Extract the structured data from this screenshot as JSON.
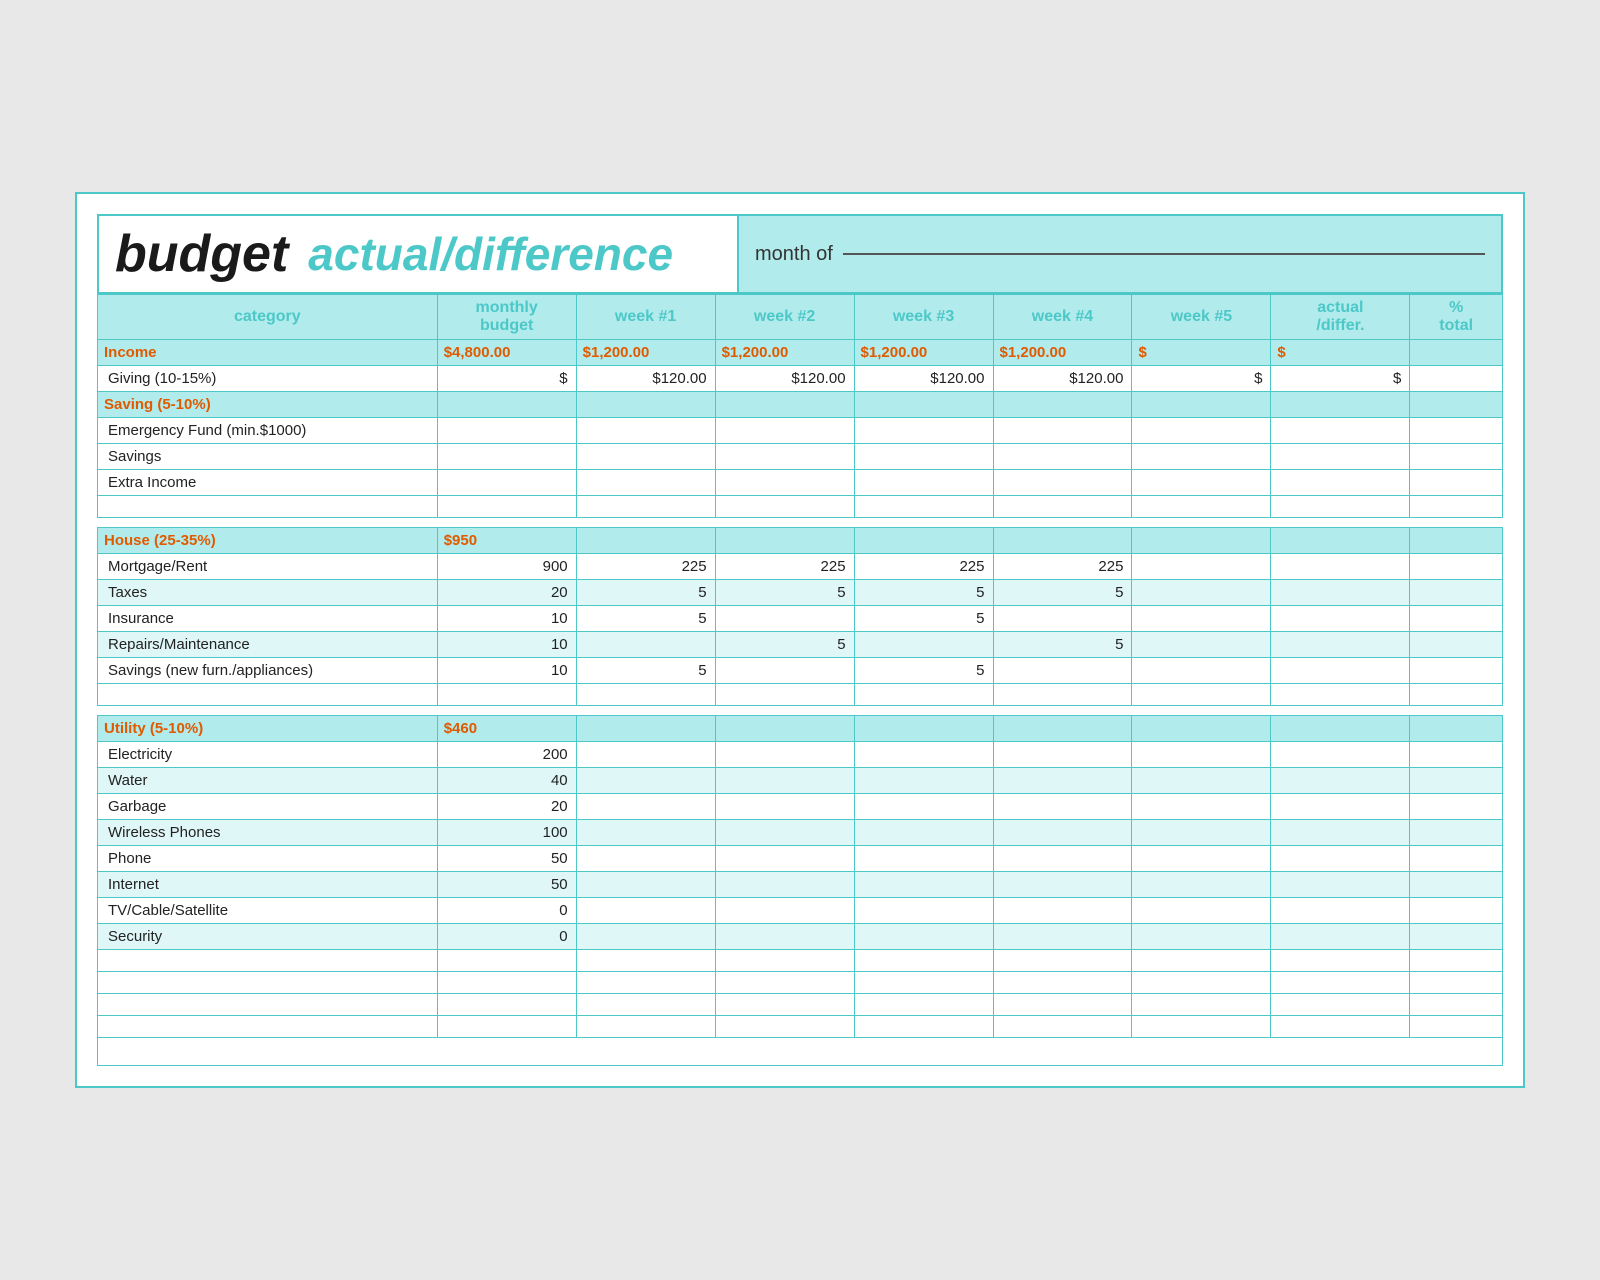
{
  "header": {
    "budget_word": "budget",
    "actual_diff": "actual/difference",
    "month_of_label": "month of"
  },
  "columns": {
    "category": "category",
    "monthly_budget": "monthly\nbudget",
    "week1": "week #1",
    "week2": "week #2",
    "week3": "week #3",
    "week4": "week #4",
    "week5": "week #5",
    "actual_differ": "actual\n/differ.",
    "pct_total": "%\ntotal"
  },
  "sections": [
    {
      "header": {
        "category": "Income",
        "monthly_budget": "$4,800.00",
        "week1": "$1,200.00",
        "week2": "$1,200.00",
        "week3": "$1,200.00",
        "week4": "$1,200.00",
        "week5": "$",
        "actual": "$",
        "pct": ""
      },
      "is_income": true,
      "rows": [
        {
          "category": "Giving (10-15%)",
          "monthly_budget": "$",
          "week1": "$120.00",
          "week2": "$120.00",
          "week3": "$120.00",
          "week4": "$120.00",
          "week5": "$",
          "actual": "$",
          "pct": ""
        },
        {
          "category": "Saving (5-10%)",
          "monthly_budget": "",
          "week1": "",
          "week2": "",
          "week3": "",
          "week4": "",
          "week5": "",
          "actual": "",
          "pct": "",
          "section": true
        },
        {
          "category": "Emergency Fund (min.$1000)",
          "monthly_budget": "",
          "week1": "",
          "week2": "",
          "week3": "",
          "week4": "",
          "week5": "",
          "actual": "",
          "pct": ""
        },
        {
          "category": "Savings",
          "monthly_budget": "",
          "week1": "",
          "week2": "",
          "week3": "",
          "week4": "",
          "week5": "",
          "actual": "",
          "pct": ""
        },
        {
          "category": "Extra Income",
          "monthly_budget": "",
          "week1": "",
          "week2": "",
          "week3": "",
          "week4": "",
          "week5": "",
          "actual": "",
          "pct": ""
        },
        {
          "category": "",
          "monthly_budget": "",
          "week1": "",
          "week2": "",
          "week3": "",
          "week4": "",
          "week5": "",
          "actual": "",
          "pct": "",
          "empty": true
        }
      ]
    },
    {
      "header": {
        "category": "House (25-35%)",
        "monthly_budget": "$950",
        "week1": "",
        "week2": "",
        "week3": "",
        "week4": "",
        "week5": "",
        "actual": "",
        "pct": ""
      },
      "rows": [
        {
          "category": "Mortgage/Rent",
          "monthly_budget": "900",
          "week1": "225",
          "week2": "225",
          "week3": "225",
          "week4": "225",
          "week5": "",
          "actual": "",
          "pct": ""
        },
        {
          "category": "Taxes",
          "monthly_budget": "20",
          "week1": "5",
          "week2": "5",
          "week3": "5",
          "week4": "5",
          "week5": "",
          "actual": "",
          "pct": "",
          "teal": true
        },
        {
          "category": "Insurance",
          "monthly_budget": "10",
          "week1": "5",
          "week2": "",
          "week3": "5",
          "week4": "",
          "week5": "",
          "actual": "",
          "pct": ""
        },
        {
          "category": "Repairs/Maintenance",
          "monthly_budget": "10",
          "week1": "",
          "week2": "5",
          "week3": "",
          "week4": "5",
          "week5": "",
          "actual": "",
          "pct": "",
          "teal": true
        },
        {
          "category": "Savings (new furn./appliances)",
          "monthly_budget": "10",
          "week1": "5",
          "week2": "",
          "week3": "5",
          "week4": "",
          "week5": "",
          "actual": "",
          "pct": ""
        },
        {
          "category": "",
          "monthly_budget": "",
          "week1": "",
          "week2": "",
          "week3": "",
          "week4": "",
          "week5": "",
          "actual": "",
          "pct": "",
          "empty": true
        }
      ]
    },
    {
      "header": {
        "category": "Utility (5-10%)",
        "monthly_budget": "$460",
        "week1": "",
        "week2": "",
        "week3": "",
        "week4": "",
        "week5": "",
        "actual": "",
        "pct": ""
      },
      "rows": [
        {
          "category": "Electricity",
          "monthly_budget": "200",
          "week1": "",
          "week2": "",
          "week3": "",
          "week4": "",
          "week5": "",
          "actual": "",
          "pct": ""
        },
        {
          "category": "Water",
          "monthly_budget": "40",
          "week1": "",
          "week2": "",
          "week3": "",
          "week4": "",
          "week5": "",
          "actual": "",
          "pct": "",
          "teal": true
        },
        {
          "category": "Garbage",
          "monthly_budget": "20",
          "week1": "",
          "week2": "",
          "week3": "",
          "week4": "",
          "week5": "",
          "actual": "",
          "pct": ""
        },
        {
          "category": "Wireless Phones",
          "monthly_budget": "100",
          "week1": "",
          "week2": "",
          "week3": "",
          "week4": "",
          "week5": "",
          "actual": "",
          "pct": "",
          "teal": true
        },
        {
          "category": "Phone",
          "monthly_budget": "50",
          "week1": "",
          "week2": "",
          "week3": "",
          "week4": "",
          "week5": "",
          "actual": "",
          "pct": ""
        },
        {
          "category": "Internet",
          "monthly_budget": "50",
          "week1": "",
          "week2": "",
          "week3": "",
          "week4": "",
          "week5": "",
          "actual": "",
          "pct": "",
          "teal": true
        },
        {
          "category": "TV/Cable/Satellite",
          "monthly_budget": "0",
          "week1": "",
          "week2": "",
          "week3": "",
          "week4": "",
          "week5": "",
          "actual": "",
          "pct": ""
        },
        {
          "category": "Security",
          "monthly_budget": "0",
          "week1": "",
          "week2": "",
          "week3": "",
          "week4": "",
          "week5": "",
          "actual": "",
          "pct": "",
          "teal": true
        },
        {
          "category": "",
          "monthly_budget": "",
          "week1": "",
          "week2": "",
          "week3": "",
          "week4": "",
          "week5": "",
          "actual": "",
          "pct": "",
          "empty": true
        },
        {
          "category": "",
          "monthly_budget": "",
          "week1": "",
          "week2": "",
          "week3": "",
          "week4": "",
          "week5": "",
          "actual": "",
          "pct": "",
          "empty": true
        },
        {
          "category": "",
          "monthly_budget": "",
          "week1": "",
          "week2": "",
          "week3": "",
          "week4": "",
          "week5": "",
          "actual": "",
          "pct": "",
          "empty": true
        },
        {
          "category": "",
          "monthly_budget": "",
          "week1": "",
          "week2": "",
          "week3": "",
          "week4": "",
          "week5": "",
          "actual": "",
          "pct": "",
          "empty": true
        }
      ]
    }
  ]
}
